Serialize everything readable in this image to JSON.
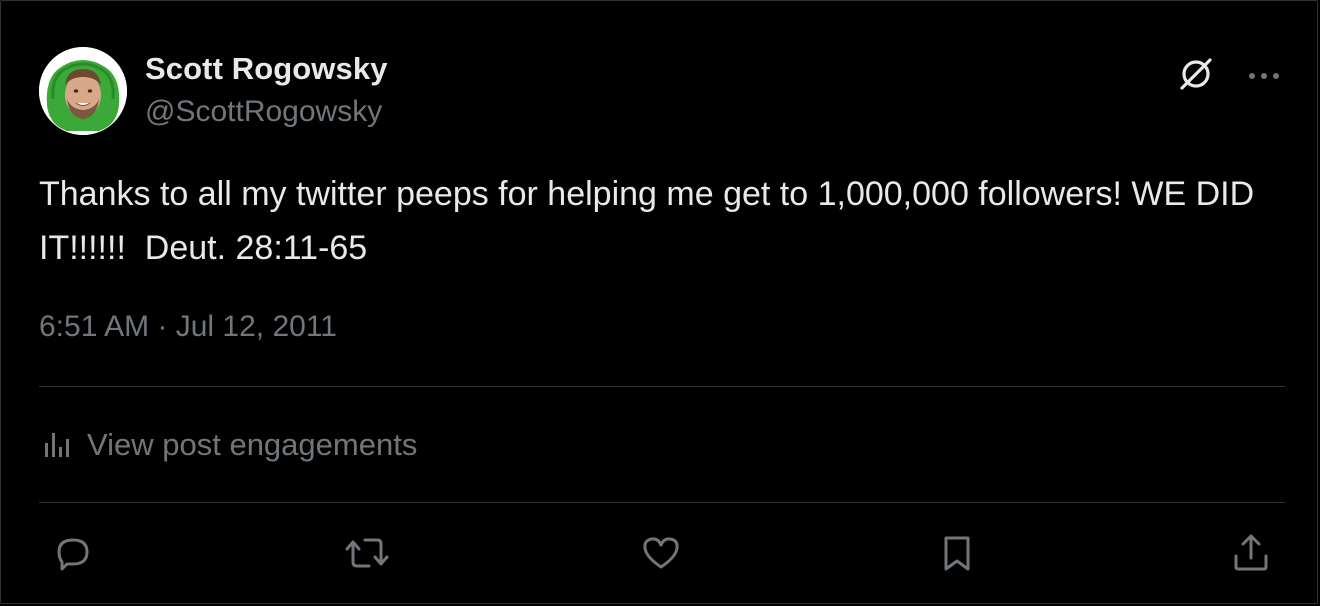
{
  "post": {
    "author": {
      "display_name": "Scott Rogowsky",
      "handle": "@ScottRogowsky",
      "avatar": "profile-photo"
    },
    "text": "Thanks to all my twitter peeps for helping me get to 1,000,000 followers! WE DID IT!!!!!!  Deut. 28:11-65",
    "timestamp": "6:51 AM · Jul 12, 2011",
    "engagements_label": "View post engagements"
  },
  "header_actions": {
    "grok_icon": "grok-icon",
    "more_icon": "more-icon"
  },
  "actions": [
    {
      "name": "reply",
      "icon": "reply-icon"
    },
    {
      "name": "repost",
      "icon": "repost-icon"
    },
    {
      "name": "like",
      "icon": "heart-icon"
    },
    {
      "name": "bookmark",
      "icon": "bookmark-icon"
    },
    {
      "name": "share",
      "icon": "share-icon"
    }
  ],
  "colors": {
    "background": "#000000",
    "primary_text": "#e7e9ea",
    "secondary_text": "#71767b",
    "divider": "#2f3336",
    "avatar_accent": "#3aa93a"
  }
}
